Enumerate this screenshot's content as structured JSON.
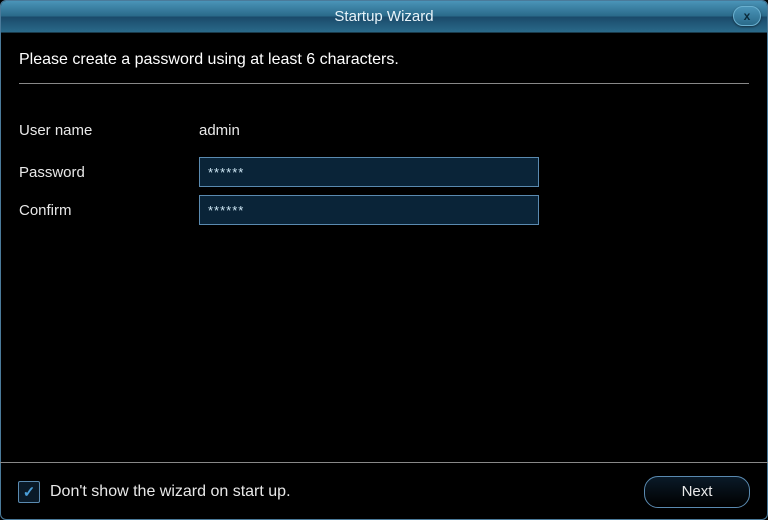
{
  "titlebar": {
    "title": "Startup Wizard",
    "close_label": "x"
  },
  "instruction": "Please create a password using at least 6 characters.",
  "form": {
    "username_label": "User name",
    "username_value": "admin",
    "password_label": "Password",
    "password_value": "******",
    "confirm_label": "Confirm",
    "confirm_value": "******"
  },
  "footer": {
    "checkbox_checked": true,
    "checkbox_label": "Don't show the wizard on start up.",
    "next_label": "Next"
  }
}
